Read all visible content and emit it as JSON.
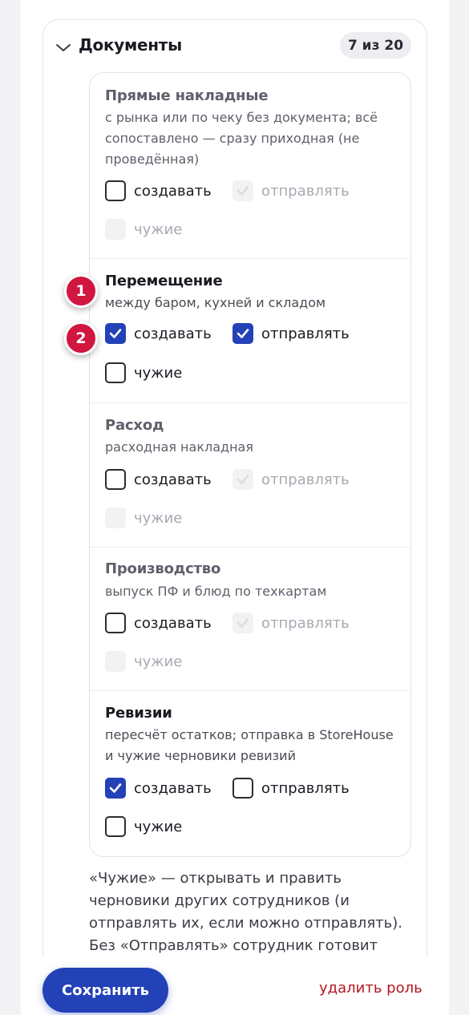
{
  "section": {
    "title": "Документы",
    "counter": "7 из 20"
  },
  "items": [
    {
      "title": "Прямые накладные",
      "desc": "с рынка или по чеку без документа; всё сопоставлено — сразу приходная (не проведённая)",
      "create": {
        "label": "создавать",
        "checked": false,
        "disabled": false
      },
      "send": {
        "label": "отправлять",
        "checked": true,
        "disabled": true
      },
      "foreign": {
        "label": "чужие",
        "checked": false,
        "disabled": true
      }
    },
    {
      "title": "Перемещение",
      "desc": "между баром, кухней и складом",
      "create": {
        "label": "создавать",
        "checked": true,
        "disabled": false
      },
      "send": {
        "label": "отправлять",
        "checked": true,
        "disabled": false
      },
      "foreign": {
        "label": "чужие",
        "checked": false,
        "disabled": false
      }
    },
    {
      "title": "Расход",
      "desc": "расходная накладная",
      "create": {
        "label": "создавать",
        "checked": false,
        "disabled": false
      },
      "send": {
        "label": "отправлять",
        "checked": true,
        "disabled": true
      },
      "foreign": {
        "label": "чужие",
        "checked": false,
        "disabled": true
      }
    },
    {
      "title": "Производство",
      "desc": "выпуск ПФ и блюд по техкартам",
      "create": {
        "label": "создавать",
        "checked": false,
        "disabled": false
      },
      "send": {
        "label": "отправлять",
        "checked": true,
        "disabled": true
      },
      "foreign": {
        "label": "чужие",
        "checked": false,
        "disabled": true
      }
    },
    {
      "title": "Ревизии",
      "desc": "пересчёт остатков; отправка в StoreHouse и чужие черновики ревизий",
      "create": {
        "label": "создавать",
        "checked": true,
        "disabled": false
      },
      "send": {
        "label": "отправлять",
        "checked": false,
        "disabled": false
      },
      "foreign": {
        "label": "чужие",
        "checked": false,
        "disabled": false
      }
    }
  ],
  "note": "«Чужие» — открывать и править черновики других сотрудников (и отправлять их, если можно отправлять). Без «Отправлять» сотрудник готовит",
  "badges": [
    "1",
    "2"
  ],
  "footer": {
    "save_label": "Сохранить",
    "delete_label": "удалить роль"
  },
  "colors": {
    "accent": "#2342b8",
    "danger": "#b3171f",
    "badge": "#d1163f"
  }
}
